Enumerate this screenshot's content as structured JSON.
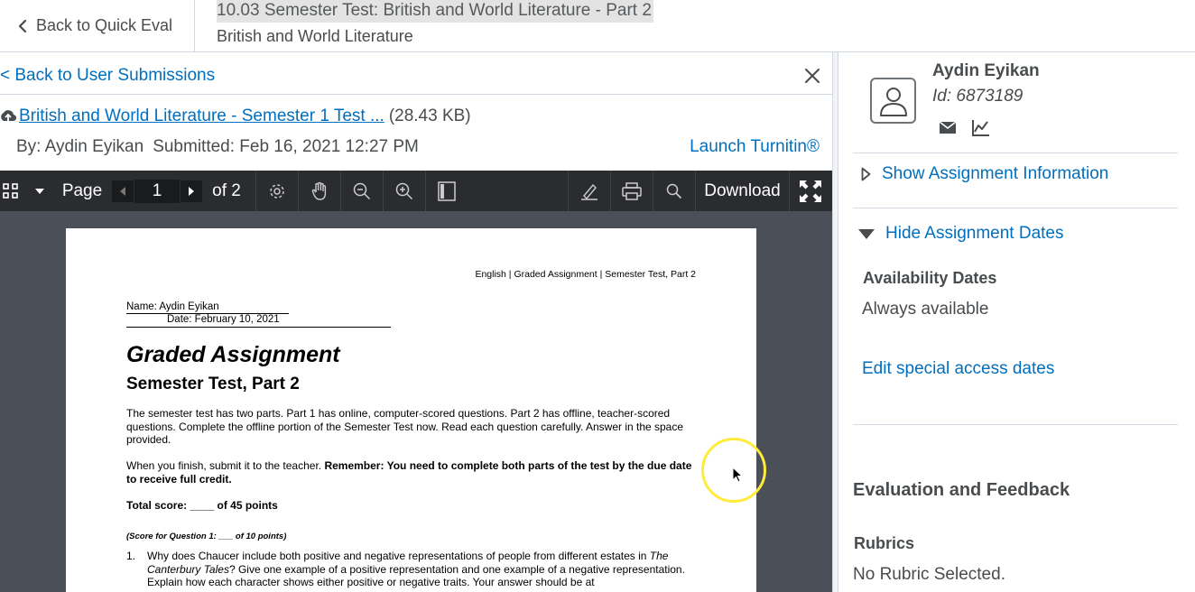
{
  "header": {
    "back_label": "Back to Quick Eval",
    "title": "10.03 Semester Test: British and World Literature - Part 2",
    "subtitle": "British and World Literature"
  },
  "submission": {
    "back_label": "< Back to User Submissions",
    "file_name": "British and World Literature - Semester 1 Test ...",
    "file_size": "(28.43 KB)",
    "by": "By: Aydin Eyikan",
    "submitted": "Submitted: Feb 16, 2021 12:27 PM",
    "turnitin_label": "Launch Turnitin®"
  },
  "toolbar": {
    "page_label": "Page",
    "page_value": "1",
    "page_total": "of 2",
    "download_label": "Download"
  },
  "document": {
    "header_text": "English | Graded Assignment | Semester Test, Part 2",
    "name_line": "Name: Aydin Eyikan",
    "date_line": "Date: February 10, 2021",
    "title": "Graded Assignment",
    "subtitle": "Semester Test, Part 2",
    "para1": "The semester test has two parts. Part 1 has online, computer-scored questions. Part 2 has offline, teacher-scored questions. Complete the offline portion of the Semester Test now. Read each question carefully. Answer in the space provided.",
    "para2_start": "When you finish, submit it to the teacher. ",
    "para2_bold": "Remember: You need to complete both parts of the test by the due date to receive full credit.",
    "total_score": "Total score: ____ of 45 points",
    "q1_score": "(Score for Question 1: ___ of 10 points)",
    "q1_num": "1.",
    "q1_text_a": "Why does Chaucer include both positive and negative representations of people from different estates in ",
    "q1_text_italic": "The Canterbury Tales",
    "q1_text_b": "? Give one example of a positive representation and one example of a negative representation. Explain how each character shows either positive or negative traits. Your answer should be at"
  },
  "user": {
    "name": "Aydin Eyikan",
    "id": "Id: 6873189"
  },
  "sidebar": {
    "show_info": "Show Assignment Information",
    "hide_dates": "Hide Assignment Dates",
    "availability_label": "Availability Dates",
    "availability_value": "Always available",
    "edit_special": "Edit special access dates",
    "eval_title": "Evaluation and Feedback",
    "rubrics_label": "Rubrics",
    "rubrics_value": "No Rubric Selected."
  },
  "colors": {
    "link": "#006fbf",
    "text": "#494c4e",
    "toolbar_bg": "#2b2c2f",
    "viewer_bg": "#4b4f57",
    "cursor_highlight": "#ffeb3b"
  },
  "icons": [
    "chevron-left-icon",
    "close-icon",
    "upload-icon",
    "thumbnails-icon",
    "caret-down-icon",
    "prev-page-icon",
    "next-page-icon",
    "settings-icon",
    "hand-icon",
    "zoom-out-icon",
    "zoom-in-icon",
    "sidebar-toggle-icon",
    "annotate-icon",
    "print-icon",
    "search-icon",
    "fullscreen-icon",
    "user-avatar-icon",
    "mail-icon",
    "chart-icon",
    "triangle-right-icon",
    "triangle-down-icon",
    "mouse-cursor-icon"
  ]
}
